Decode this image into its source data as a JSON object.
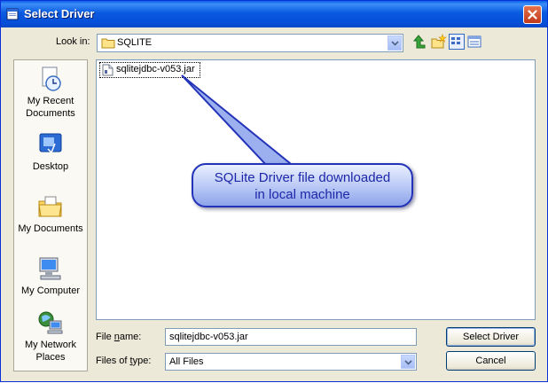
{
  "window": {
    "title": "Select Driver"
  },
  "toolbar": {
    "look_in_label": "Look in:",
    "look_in_value": "SQLITE"
  },
  "places": [
    {
      "label1": "My Recent",
      "label2": "Documents"
    },
    {
      "label1": "Desktop",
      "label2": ""
    },
    {
      "label1": "My Documents",
      "label2": ""
    },
    {
      "label1": "My Computer",
      "label2": ""
    },
    {
      "label1": "My Network",
      "label2": "Places"
    }
  ],
  "files": [
    {
      "name": "sqlitejdbc-v053.jar"
    }
  ],
  "annotation": {
    "line1": "SQLite Driver file downloaded",
    "line2": "in local machine"
  },
  "form": {
    "file_name_label_pre": "File ",
    "file_name_label_key": "n",
    "file_name_label_post": "ame:",
    "file_name_value": "sqlitejdbc-v053.jar",
    "files_of_type_label_pre": "Files of ",
    "files_of_type_label_key": "t",
    "files_of_type_label_post": "ype:",
    "files_of_type_value": "All Files"
  },
  "buttons": {
    "select": "Select Driver",
    "cancel": "Cancel"
  },
  "colors": {
    "titlebar": "#0a5ae0",
    "dialog_bg": "#ece9d8",
    "annotation_text": "#1d27a8",
    "annotation_border": "#2434b8"
  }
}
